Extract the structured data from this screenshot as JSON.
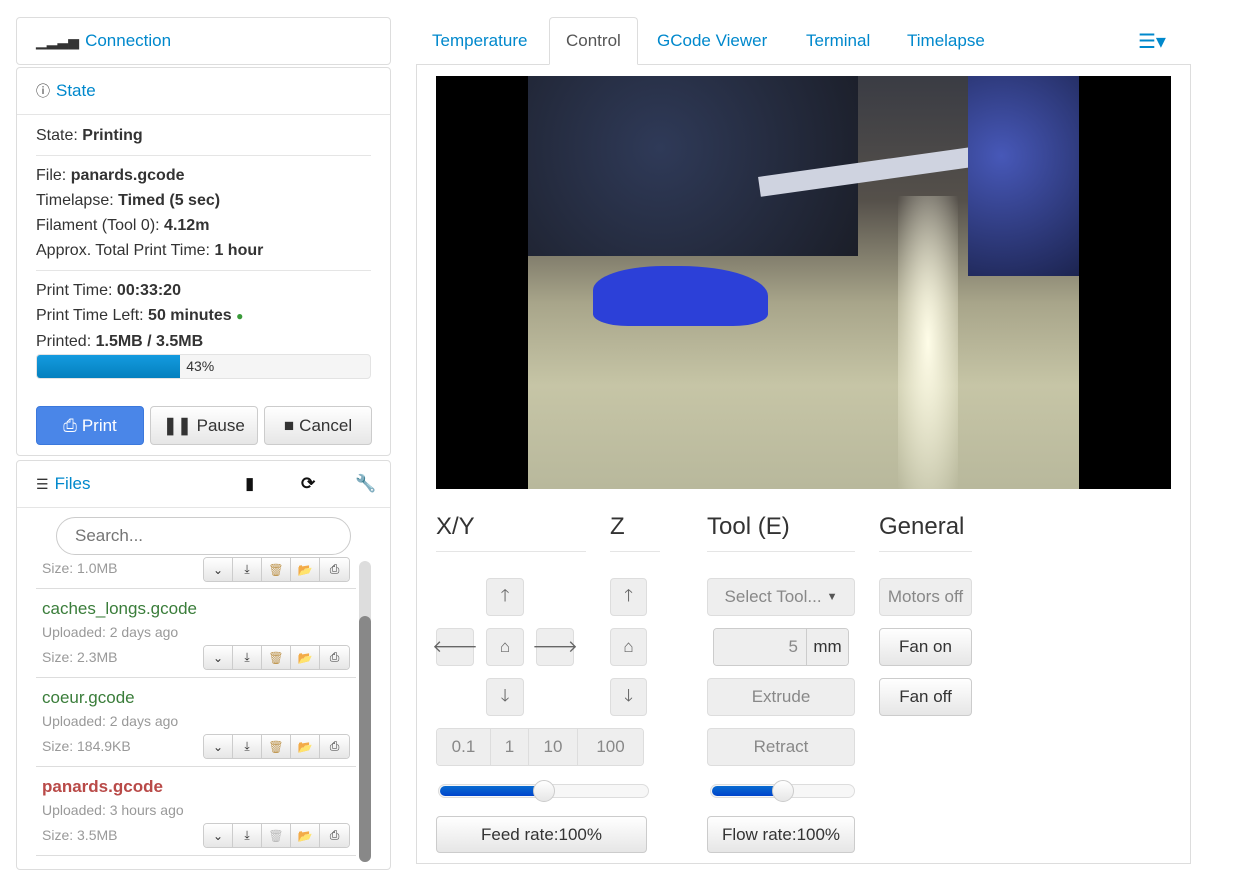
{
  "connection": {
    "title": "Connection",
    "icon": "signal-icon"
  },
  "state": {
    "title": "State",
    "state_label": "State:",
    "state_value": "Printing",
    "file_label": "File:",
    "file_value": "panards.gcode",
    "timelapse_label": "Timelapse:",
    "timelapse_value": "Timed (5 sec)",
    "filament_label": "Filament (Tool 0):",
    "filament_value": "4.12m",
    "approx_label": "Approx. Total Print Time:",
    "approx_value": "1 hour",
    "printtime_label": "Print Time:",
    "printtime_value": "00:33:20",
    "timeleft_label": "Print Time Left:",
    "timeleft_value": "50 minutes",
    "printed_label": "Printed:",
    "printed_value": "1.5MB / 3.5MB",
    "progress_percent": 43,
    "progress_text": "43%",
    "print_btn": "Print",
    "pause_btn": "Pause",
    "cancel_btn": "Cancel"
  },
  "files": {
    "title": "Files",
    "search_placeholder": "Search...",
    "partial_size": "Size: 1.0MB",
    "items": [
      {
        "name": "caches_longs.gcode",
        "uploaded": "Uploaded: 2 days ago",
        "size": "Size: 2.3MB",
        "color": "#3a7d3a"
      },
      {
        "name": "coeur.gcode",
        "uploaded": "Uploaded: 2 days ago",
        "size": "Size: 184.9KB",
        "color": "#3a7d3a"
      },
      {
        "name": "panards.gcode",
        "uploaded": "Uploaded: 3 hours ago",
        "size": "Size: 3.5MB",
        "color": "#b94a48"
      }
    ]
  },
  "tabs": [
    "Temperature",
    "Control",
    "GCode Viewer",
    "Terminal",
    "Timelapse"
  ],
  "active_tab": "Control",
  "control": {
    "xy_title": "X/Y",
    "z_title": "Z",
    "tool_title": "Tool (E)",
    "general_title": "General",
    "steps": [
      "0.1",
      "1",
      "10",
      "100"
    ],
    "feed_rate": "Feed rate:100%",
    "feed_slider_percent": 50,
    "select_tool": "Select Tool...",
    "extrude_amount": "5",
    "extrude_unit": "mm",
    "extrude": "Extrude",
    "retract": "Retract",
    "flow_rate": "Flow rate:100%",
    "flow_slider_percent": 50,
    "motors_off": "Motors off",
    "fan_on": "Fan on",
    "fan_off": "Fan off"
  }
}
